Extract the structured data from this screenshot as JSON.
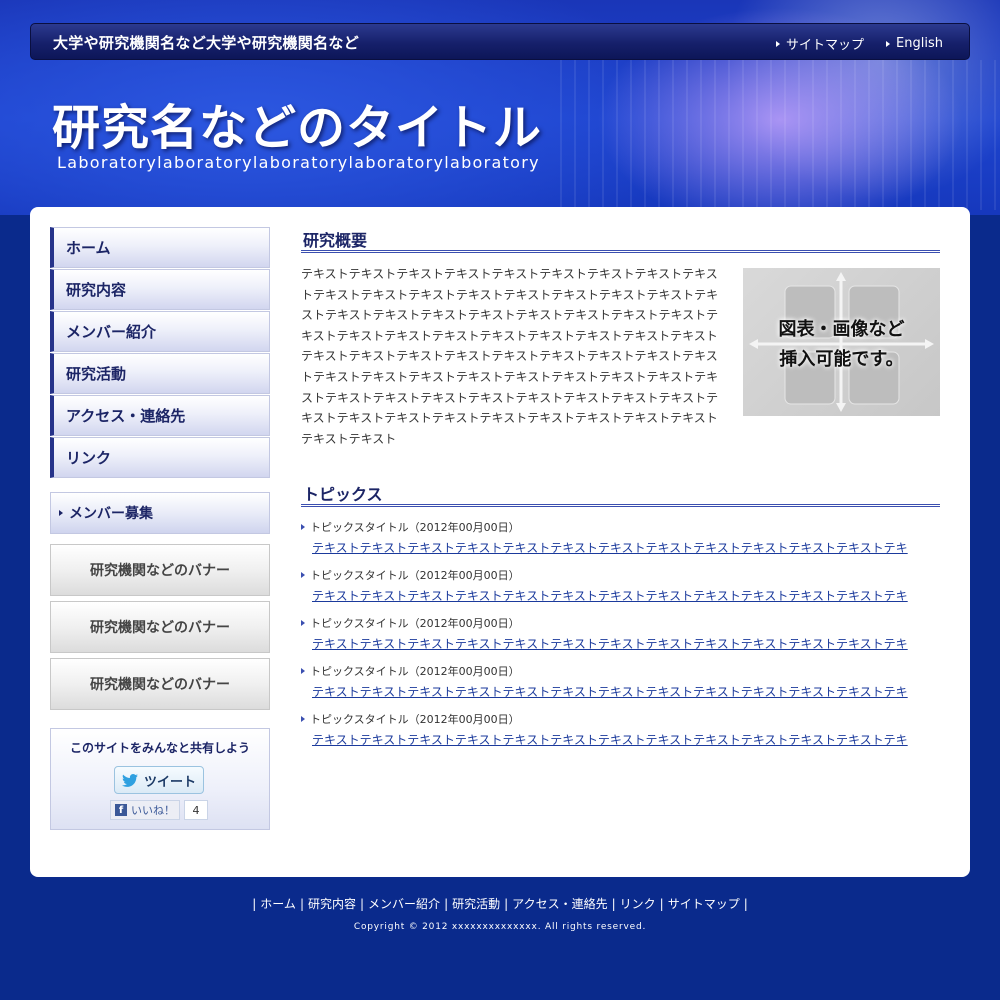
{
  "header": {
    "affiliation": "大学や研究機関名など大学や研究機関名など",
    "top_links": [
      "サイトマップ",
      "English"
    ],
    "title": "研究名などのタイトル",
    "subtitle": "Laboratorylaboratorylaboratorylaboratorylaboratory"
  },
  "sidebar": {
    "nav": [
      "ホーム",
      "研究内容",
      "メンバー紹介",
      "研究活動",
      "アクセス・連絡先",
      "リンク"
    ],
    "recruit": "メンバー募集",
    "banners": [
      "研究機関などのバナー",
      "研究機関などのバナー",
      "研究機関などのバナー"
    ],
    "share": {
      "text": "このサイトをみんなと共有しよう",
      "tweet": "ツイート",
      "like": "いいね！",
      "like_count": "4"
    }
  },
  "main": {
    "overview_heading": "研究概要",
    "overview_text": "テキストテキストテキストテキストテキストテキストテキストテキストテキストテキストテキストテキストテキストテキストテキストテキストテキストテキストテキストテキストテキストテキストテキストテキストテキストテキストテキストテキストテキストテキストテキストテキストテキストテキストテキストテキストテキストテキストテキストテキストテキストテキストテキストテキストテキストテキストテキストテキストテキストテキストテキストテキストテキストテキストテキストテキストテキストテキストテキストテキストテキストテキストテキストテキストテキストテキストテキストテキストテキストテキストテキストテキスト",
    "figure_text_1": "図表・画像など",
    "figure_text_2": "挿入可能です。",
    "topics_heading": "トピックス",
    "topics": [
      {
        "title": "トピックスタイトル（2012年00月00日）",
        "link": "テキストテキストテキストテキストテキストテキストテキストテキストテキストテキストテキストテキストテキ"
      },
      {
        "title": "トピックスタイトル（2012年00月00日）",
        "link": "テキストテキストテキストテキストテキストテキストテキストテキストテキストテキストテキストテキストテキ"
      },
      {
        "title": "トピックスタイトル（2012年00月00日）",
        "link": "テキストテキストテキストテキストテキストテキストテキストテキストテキストテキストテキストテキストテキ"
      },
      {
        "title": "トピックスタイトル（2012年00月00日）",
        "link": "テキストテキストテキストテキストテキストテキストテキストテキストテキストテキストテキストテキストテキ"
      },
      {
        "title": "トピックスタイトル（2012年00月00日）",
        "link": "テキストテキストテキストテキストテキストテキストテキストテキストテキストテキストテキストテキストテキ"
      }
    ]
  },
  "footer": {
    "links": [
      "ホーム",
      "研究内容",
      "メンバー紹介",
      "研究活動",
      "アクセス・連絡先",
      "リンク",
      "サイトマップ"
    ],
    "copyright": "Copyright © 2012 xxxxxxxxxxxxxx. All rights reserved."
  }
}
